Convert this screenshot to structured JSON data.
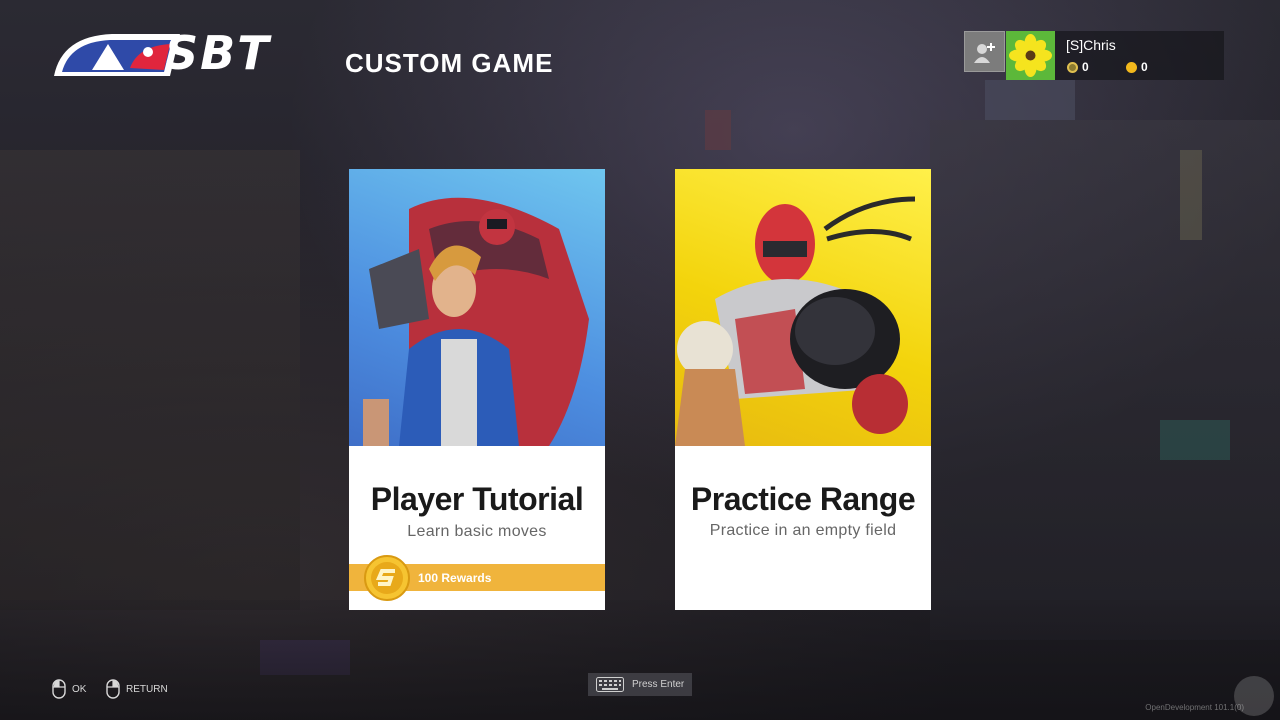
{
  "header": {
    "logo_text": "SBT",
    "title": "CUSTOM GAME"
  },
  "user": {
    "name": "[S]Chris",
    "currency_1": "0",
    "currency_2": "0"
  },
  "cards": [
    {
      "title": "Player Tutorial",
      "subtitle": "Learn basic moves",
      "reward": "100 Rewards"
    },
    {
      "title": "Practice Range",
      "subtitle": "Practice in an empty field"
    }
  ],
  "footer": {
    "ok_label": "OK",
    "return_label": "RETURN",
    "press_enter_label": "Press Enter",
    "version": "OpenDevelopment 101.1(0)"
  },
  "colors": {
    "reward_band": "#f0b43c",
    "avatar_bg": "#5cb83a",
    "tutorial_art": "#4d8ee0",
    "practice_art": "#f3d40c"
  },
  "icons": {
    "add_friend": "add-friend-icon",
    "avatar": "flower-avatar-icon",
    "currency_1": "token-icon",
    "currency_2": "gold-coin-icon",
    "reward": "reward-coin-icon",
    "ok": "mouse-left-icon",
    "return": "mouse-right-icon",
    "keyboard": "keyboard-icon"
  }
}
